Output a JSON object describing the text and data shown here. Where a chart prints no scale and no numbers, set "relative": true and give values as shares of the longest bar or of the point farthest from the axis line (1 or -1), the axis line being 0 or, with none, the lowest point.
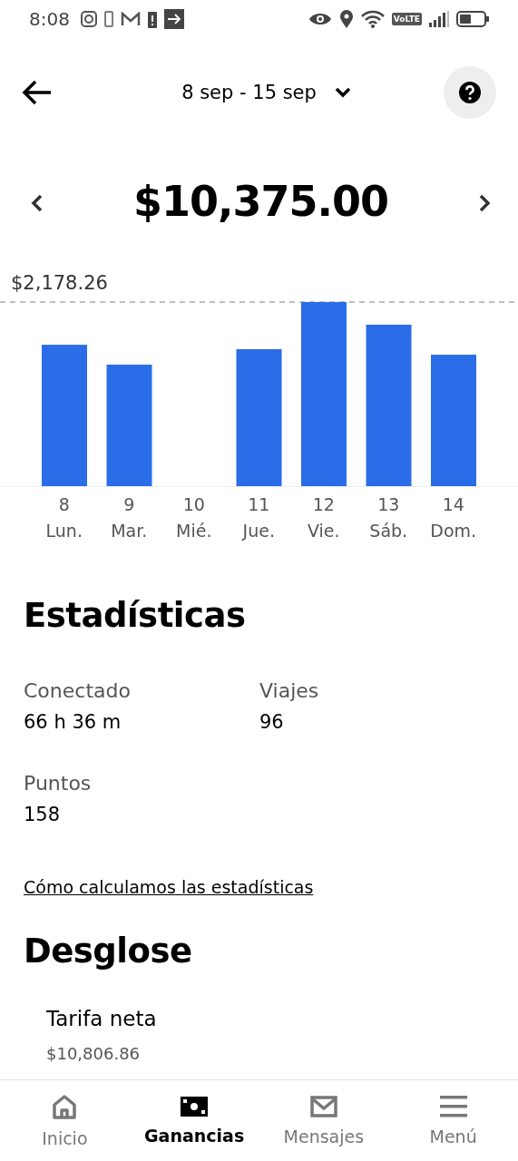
{
  "status_bar": {
    "time": "8:08",
    "volte": "VoLTE"
  },
  "header": {
    "period": "8 sep - 15 sep"
  },
  "total": {
    "amount": "$10,375.00"
  },
  "earnings_chart": {
    "chart_data": {
      "type": "bar",
      "categories": [
        "8",
        "9",
        "10",
        "11",
        "12",
        "13",
        "14"
      ],
      "relative": true,
      "series": [
        {
          "color": "#2b6de8",
          "values": [
            0.768,
            0.66,
            0,
            0.744,
            1,
            0.877,
            0.714
          ]
        }
      ],
      "annotations": [
        "$2,178.26"
      ]
    },
    "day_names": [
      "Lun.",
      "Mar.",
      "Mié.",
      "Jue.",
      "Vie.",
      "Sáb.",
      "Dom."
    ]
  },
  "statistics": {
    "title": "Estadísticas",
    "items": [
      {
        "label": "Conectado",
        "value": "66 h 36 m"
      },
      {
        "label": "Viajes",
        "value": "96"
      },
      {
        "label": "Puntos",
        "value": "158"
      }
    ],
    "link": "Cómo calculamos las estadísticas"
  },
  "breakdown": {
    "title": "Desglose",
    "items": [
      {
        "label": "Tarifa neta",
        "value": "$10,806.86"
      }
    ]
  },
  "bottom_nav": [
    {
      "kind": "home",
      "label": "Inicio",
      "selected": false
    },
    {
      "kind": "cash",
      "label": "Ganancias",
      "selected": true
    },
    {
      "kind": "mail",
      "label": "Mensajes",
      "selected": false
    },
    {
      "kind": "menu",
      "label": "Menú",
      "selected": false
    }
  ]
}
